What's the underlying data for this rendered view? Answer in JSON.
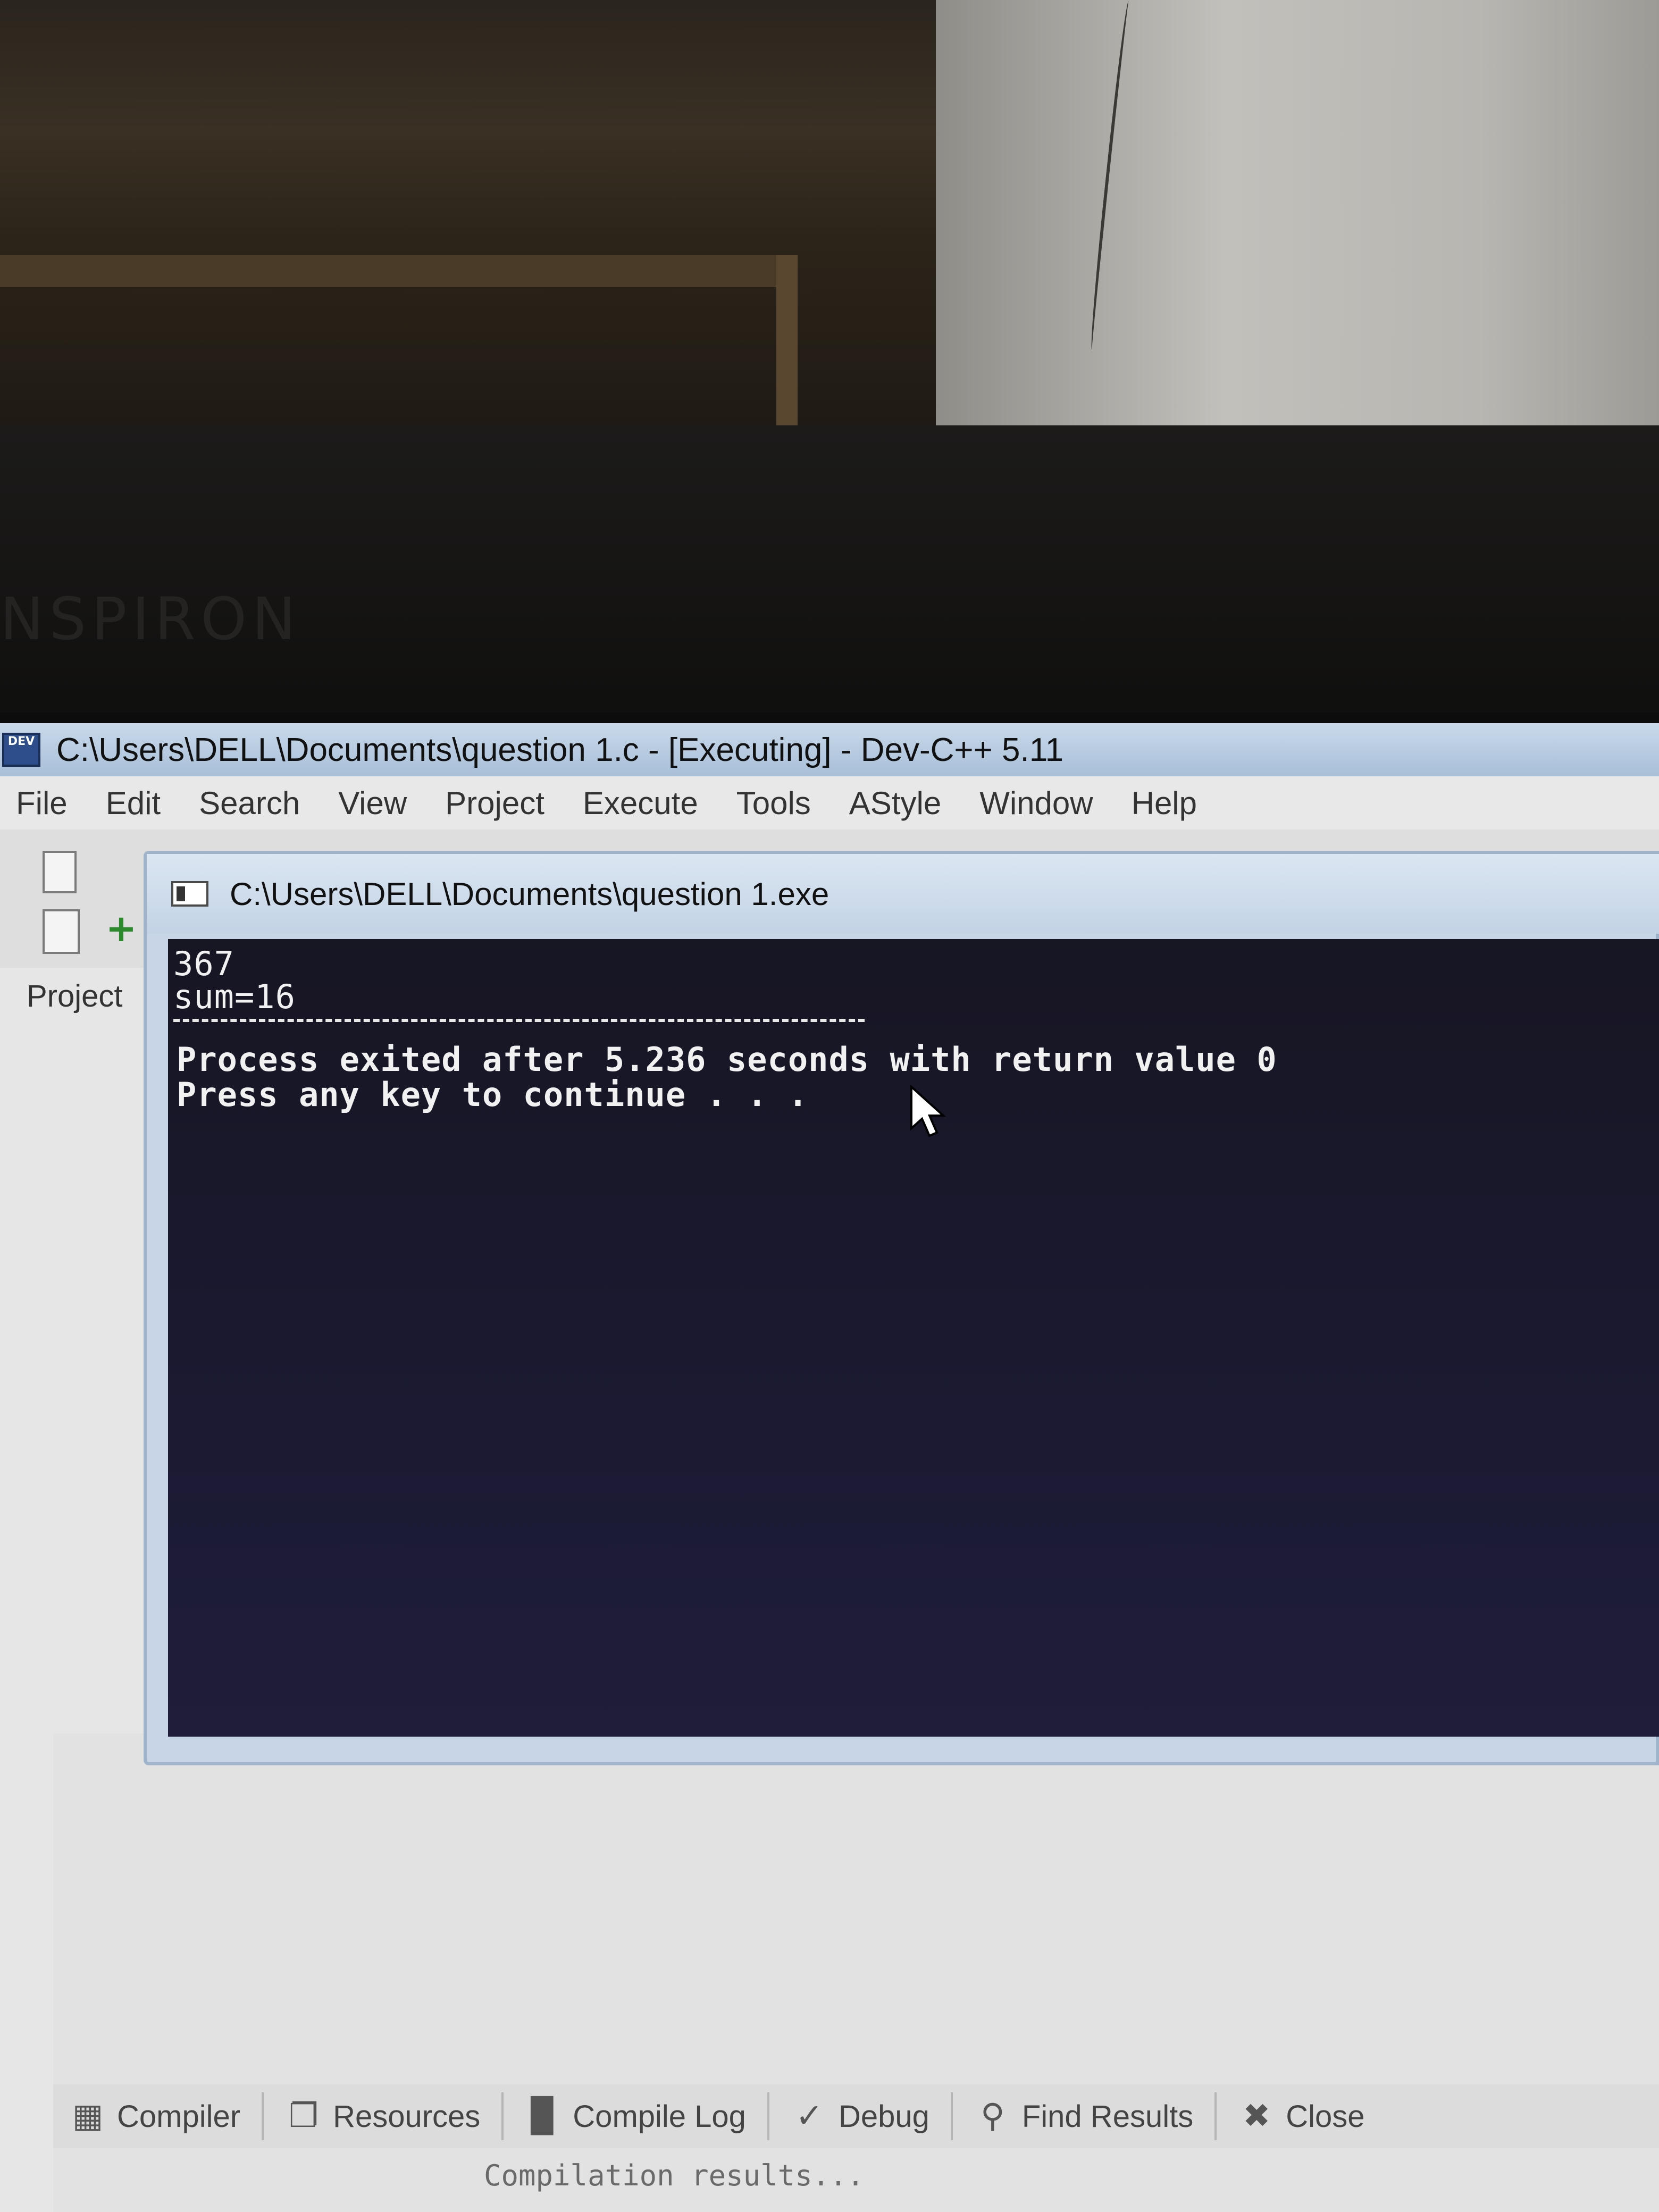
{
  "laptop_brand": "NSPIRON",
  "devcpp": {
    "icon_label": "DEV",
    "title": "C:\\Users\\DELL\\Documents\\question 1.c - [Executing] - Dev-C++ 5.11",
    "menu": [
      "File",
      "Edit",
      "Search",
      "View",
      "Project",
      "Execute",
      "Tools",
      "AStyle",
      "Window",
      "Help"
    ],
    "left_panel_tab": "Project",
    "bottom_tabs": [
      {
        "label": "Compiler",
        "icon": "grid-icon"
      },
      {
        "label": "Resources",
        "icon": "resources-icon"
      },
      {
        "label": "Compile Log",
        "icon": "bar-chart-icon"
      },
      {
        "label": "Debug",
        "icon": "check-icon"
      },
      {
        "label": "Find Results",
        "icon": "find-icon"
      },
      {
        "label": "Close",
        "icon": "close-icon"
      }
    ],
    "compile_status": "Compilation results..."
  },
  "console": {
    "title": "C:\\Users\\DELL\\Documents\\question 1.exe",
    "lines": [
      "367",
      "sum=16",
      "Process exited after 5.236 seconds with return value 0",
      "Press any key to continue . . ."
    ]
  },
  "colors": {
    "console_bg": "#1a1930",
    "console_text": "#f1f1f1",
    "titlebar": "#c9d9ea"
  }
}
